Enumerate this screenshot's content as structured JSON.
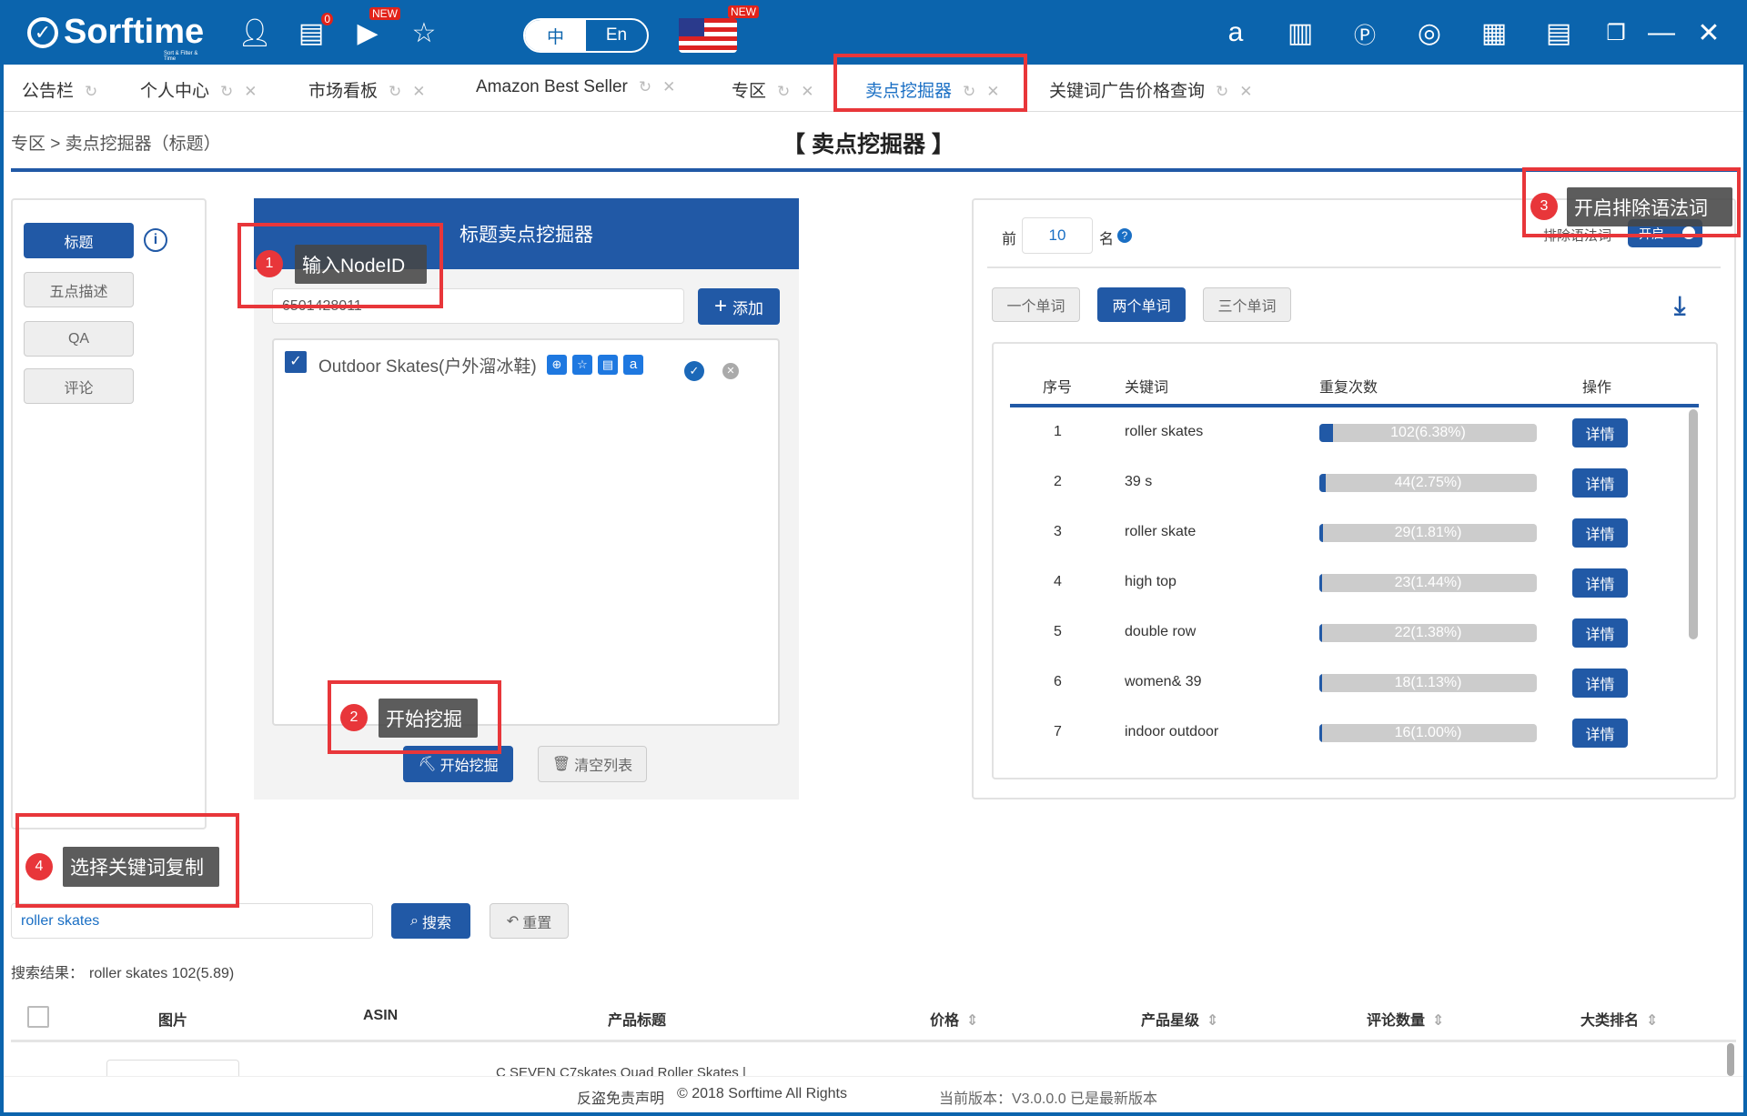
{
  "header": {
    "brand": "Sorftime",
    "tagline": "Sort & Filter & Time",
    "msg_count": "0",
    "new_badge": "NEW",
    "lang_cn": "中",
    "lang_en": "En"
  },
  "tabs": [
    {
      "label": "公告栏"
    },
    {
      "label": "个人中心"
    },
    {
      "label": "市场看板"
    },
    {
      "label": "Amazon Best Seller"
    },
    {
      "label": "专区"
    },
    {
      "label": "卖点挖掘器",
      "active": true
    },
    {
      "label": "关键词广告价格查询"
    }
  ],
  "breadcrumb": "专区 > 卖点挖掘器（标题）",
  "page_title": "【 卖点挖掘器 】",
  "sidebar": {
    "items": [
      {
        "label": "标题",
        "active": true
      },
      {
        "label": "五点描述"
      },
      {
        "label": "QA"
      },
      {
        "label": "评论"
      }
    ]
  },
  "miner": {
    "title": "标题卖点挖掘器",
    "node_input": "6501428011",
    "add_label": "添加",
    "list": [
      {
        "label": "Outdoor Skates(户外溜冰鞋)",
        "checked": true
      }
    ],
    "start_label": "开始挖掘",
    "clear_label": "清空列表"
  },
  "results": {
    "top_prefix": "前",
    "top_value": "10",
    "top_suffix": "名",
    "exclude_label": "排除语法词",
    "exclude_toggle": "开启",
    "word_tabs": [
      {
        "label": "一个单词"
      },
      {
        "label": "两个单词",
        "active": true
      },
      {
        "label": "三个单词"
      }
    ],
    "columns": [
      "序号",
      "关键词",
      "重复次数",
      "操作"
    ],
    "detail_label": "详情",
    "rows": [
      {
        "no": "1",
        "kw": "roller skates",
        "count": "102(6.38%)",
        "pct": 6.38
      },
      {
        "no": "2",
        "kw": "39 s",
        "count": "44(2.75%)",
        "pct": 2.75
      },
      {
        "no": "3",
        "kw": "roller skate",
        "count": "29(1.81%)",
        "pct": 1.81
      },
      {
        "no": "4",
        "kw": "high top",
        "count": "23(1.44%)",
        "pct": 1.44
      },
      {
        "no": "5",
        "kw": "double row",
        "count": "22(1.38%)",
        "pct": 1.38
      },
      {
        "no": "6",
        "kw": "women& 39",
        "count": "18(1.13%)",
        "pct": 1.13
      },
      {
        "no": "7",
        "kw": "indoor outdoor",
        "count": "16(1.00%)",
        "pct": 1.0
      }
    ]
  },
  "annotations": {
    "a1": {
      "n": "1",
      "text": "输入NodeID"
    },
    "a2": {
      "n": "2",
      "text": "开始挖掘"
    },
    "a3": {
      "n": "3",
      "text": "开启排除语法词"
    },
    "a4": {
      "n": "4",
      "text": "选择关键词复制"
    }
  },
  "search": {
    "value": "roller skates",
    "search_label": "搜索",
    "reset_label": "重置",
    "result_label": "搜索结果：",
    "result_value": "roller skates 102(5.89)"
  },
  "products": {
    "columns": [
      "图片",
      "ASIN",
      "产品标题",
      "价格",
      "产品星级",
      "评论数量",
      "大类排名"
    ],
    "partial_title": "C SEVEN C7skates Quad Roller Skates |"
  },
  "footer": {
    "disclaimer": "反盗免责声明",
    "copyright": "© 2018 Sorftime All Rights",
    "version": "当前版本：V3.0.0.0  已是最新版本"
  },
  "colors": {
    "brand": "#0b64ad",
    "primary": "#2159a6",
    "annotation": "#e8363a"
  }
}
